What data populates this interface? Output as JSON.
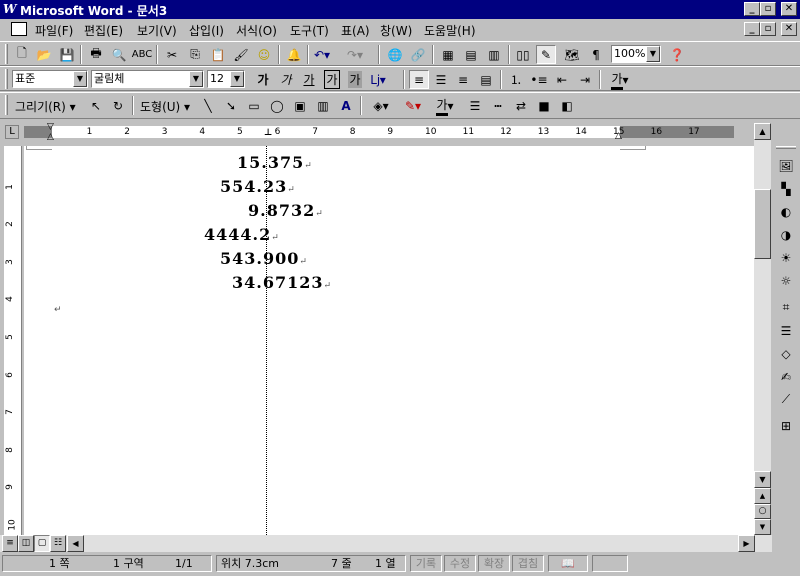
{
  "window": {
    "title": "Microsoft Word - 문서3"
  },
  "menu": [
    "파일(F)",
    "편집(E)",
    "보기(V)",
    "삽입(I)",
    "서식(O)",
    "도구(T)",
    "표(A)",
    "창(W)",
    "도움말(H)"
  ],
  "standard_toolbar": {
    "zoom": "100%"
  },
  "format_toolbar": {
    "style": "표준",
    "font": "굴림체",
    "size": "12"
  },
  "drawing_toolbar": {
    "draw_label": "그리기(R)",
    "autoshape_label": "도형(U)"
  },
  "ruler": {
    "ticks": [
      "1",
      "2",
      "3",
      "4",
      "5",
      "6",
      "7",
      "8",
      "9",
      "10",
      "11",
      "12",
      "13",
      "14",
      "15",
      "16",
      "17"
    ]
  },
  "vruler": {
    "ticks": [
      "1",
      "2",
      "3",
      "4",
      "5",
      "6",
      "7",
      "8",
      "9",
      "10"
    ]
  },
  "document": {
    "lines": [
      "15.375",
      "554.23",
      "9.8732",
      "4444.2",
      "543.900",
      "34.67123"
    ]
  },
  "status": {
    "page": "1 쪽",
    "section": "1 구역",
    "pages": "1/1",
    "position": "위치 7.3cm",
    "line": "7 줄",
    "col": "1 열",
    "rec": "기록",
    "trk": "수정",
    "ext": "확장",
    "ovr": "겹침"
  }
}
